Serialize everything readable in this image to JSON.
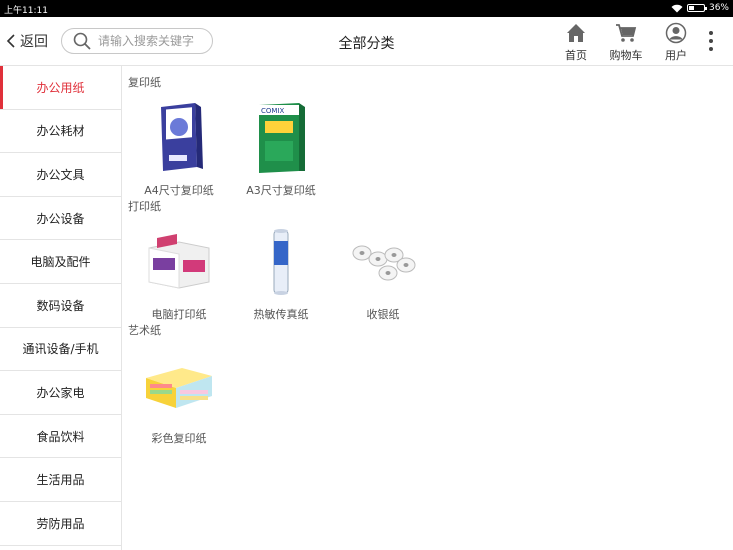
{
  "status": {
    "time": "上午11:11",
    "battery": "36%",
    "battery_level": 0.36
  },
  "header": {
    "back_label": "返回",
    "search_placeholder": "请输入搜索关键字",
    "title": "全部分类",
    "nav": [
      {
        "label": "首页",
        "icon": "home-icon"
      },
      {
        "label": "购物车",
        "icon": "cart-icon"
      },
      {
        "label": "用户",
        "icon": "user-icon"
      }
    ]
  },
  "categories": [
    {
      "label": "办公用纸",
      "active": true
    },
    {
      "label": "办公耗材"
    },
    {
      "label": "办公文具"
    },
    {
      "label": "办公设备"
    },
    {
      "label": "电脑及配件"
    },
    {
      "label": "数码设备"
    },
    {
      "label": "通讯设备/手机"
    },
    {
      "label": "办公家电"
    },
    {
      "label": "食品饮料"
    },
    {
      "label": "生活用品"
    },
    {
      "label": "劳防用品"
    }
  ],
  "sections": [
    {
      "title": "复印纸",
      "products": [
        {
          "name": "A4尺寸复印纸"
        },
        {
          "name": "A3尺寸复印纸"
        }
      ]
    },
    {
      "title": "打印纸",
      "products": [
        {
          "name": "电脑打印纸"
        },
        {
          "name": "热敏传真纸"
        },
        {
          "name": "收银纸"
        }
      ]
    },
    {
      "title": "艺术纸",
      "products": [
        {
          "name": "彩色复印纸"
        }
      ]
    }
  ],
  "brand_text": "COMIX",
  "colors": {
    "accent": "#e0303a"
  }
}
